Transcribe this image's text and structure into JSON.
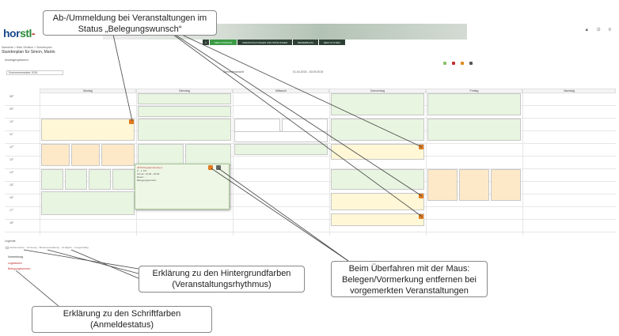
{
  "header": {
    "logo_main": "hor",
    "logo_accent": "stl",
    "top_icons": "▲ ⊙ ≡"
  },
  "nav": {
    "items": [
      "MEIN STUDIUM",
      "VERANSTALTUNGEN UND PRÜFUNGEN",
      "BEWERBUNG",
      "MEIN SYSTEM"
    ]
  },
  "breadcrumb": "Startseite > Mein Studium > Stundenplan",
  "page_title": "Stundenplan für Simon, Martin",
  "filters": {
    "label": "Anzeigeoptionen",
    "semester": "Sommersemester 2015",
    "view": "Semesteransicht",
    "range": "01.04.2015 - 30.09.2015"
  },
  "toolbar": {
    "colors": {
      "print": "#8bbf6a",
      "pdf": "#c03030",
      "outlook": "#e08a20",
      "overlap": "#555555"
    }
  },
  "days": [
    "Montag",
    "Dienstag",
    "Mittwoch",
    "Donnerstag",
    "Freitag",
    "Samstag"
  ],
  "times": [
    "08°",
    "09°",
    "10°",
    "11°",
    "12°",
    "13°",
    "14°",
    "15°",
    "16°",
    "17°",
    "18°",
    "19°"
  ],
  "popup": {
    "title": "4670 Programmierung 1",
    "lines": [
      "Ü · 1. FS",
      "Termin: 13:00 - 15:00",
      "Raum: ...",
      "Belegungswunsch"
    ]
  },
  "legend": {
    "title": "Legende",
    "row": "Fachsemester · Vorlesung · Blockveranstaltung · 14-täglich · unregelmäßig",
    "v": "Vormerkung",
    "z": "zugelassen",
    "b": "Belegungswunsch"
  },
  "callouts": {
    "top": "Ab-/Ummeldung bei Veranstaltungen im Status „Belegungswunsch“",
    "bg": "Erklärung zu den Hintergrundfarben (Veranstaltungsrhythmus)",
    "hover": "Beim Überfahren mit der Maus: Belegen/Vormerkung entfernen bei vorgemerkten Veranstaltungen",
    "font": "Erklärung zu den Schriftfarben (Anmeldestatus)"
  }
}
